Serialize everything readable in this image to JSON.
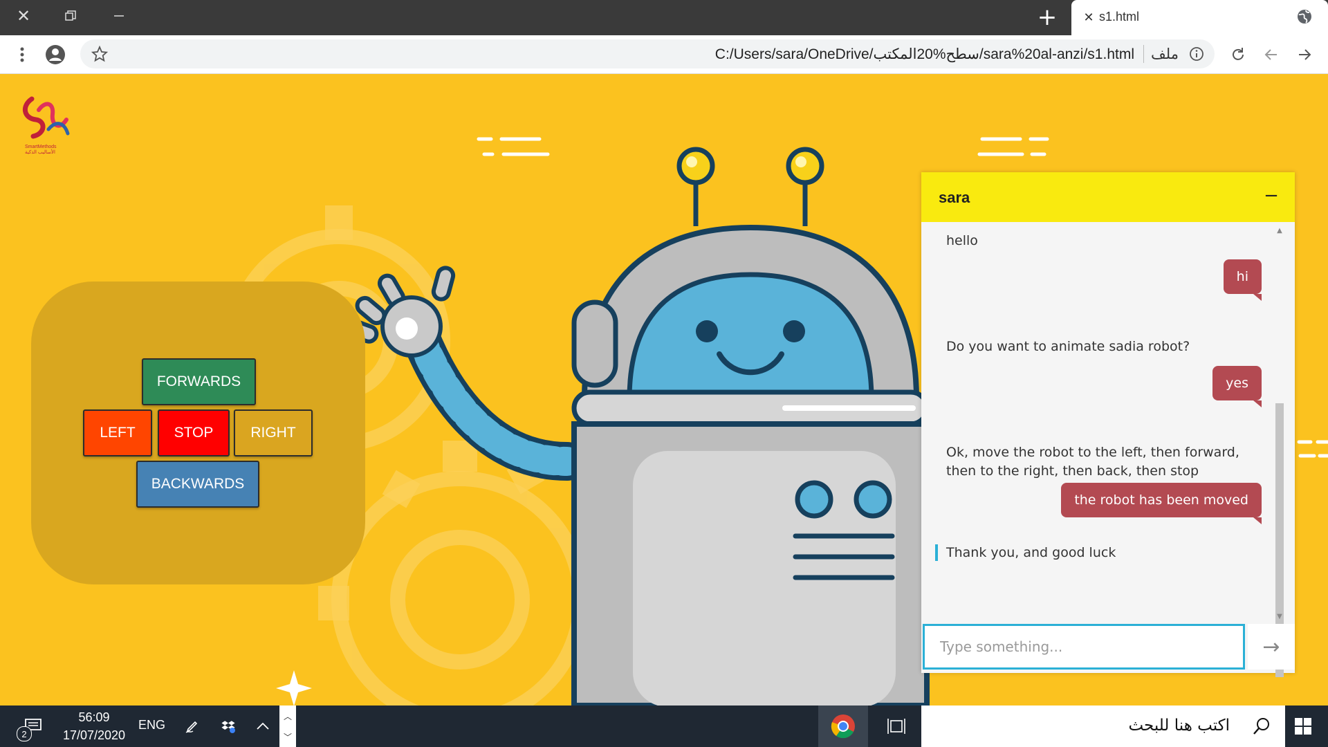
{
  "browser": {
    "tab": {
      "title": "s1.html",
      "close": "✕"
    },
    "new_tab": "+",
    "address": {
      "url": "C:/Users/sara/OneDrive/سطح%20المكتب/sara%20al-anzi/s1.html",
      "file_label": "ملف"
    }
  },
  "logo": {
    "brand": "SmartMethods",
    "brand_ar": "الأساليب الذكية"
  },
  "controls": {
    "forwards": "FORWARDS",
    "left": "LEFT",
    "stop": "STOP",
    "right": "RIGHT",
    "backwards": "BACKWARDS",
    "colors": {
      "forwards": "#2e8b57",
      "left": "#ff4500",
      "stop": "#ff0000",
      "right": "#daa520",
      "backwards": "#4682b4"
    }
  },
  "chat": {
    "title": "sara",
    "minimize": "−",
    "messages": [
      {
        "from": "bot",
        "text": "hello"
      },
      {
        "from": "user",
        "text": "hi"
      },
      {
        "from": "bot",
        "text": "Do you want to animate sadia robot?"
      },
      {
        "from": "user",
        "text": "yes"
      },
      {
        "from": "bot",
        "text": "Ok, move the robot to the left, then forward, then to the right, then back, then stop"
      },
      {
        "from": "user",
        "text": "the robot has been moved"
      },
      {
        "from": "bot",
        "text": "Thank you, and good luck"
      }
    ],
    "input_placeholder": "Type something...",
    "send": "→"
  },
  "taskbar": {
    "notifications": "2",
    "time": "56:09",
    "date": "17/07/2020",
    "lang": "ENG",
    "search_placeholder": "اكتب هنا للبحث"
  },
  "colors": {
    "page_bg": "#fbc21f",
    "chat_header": "#f9ea0f",
    "user_bubble": "#b34a52",
    "accent": "#2bb0d6"
  }
}
